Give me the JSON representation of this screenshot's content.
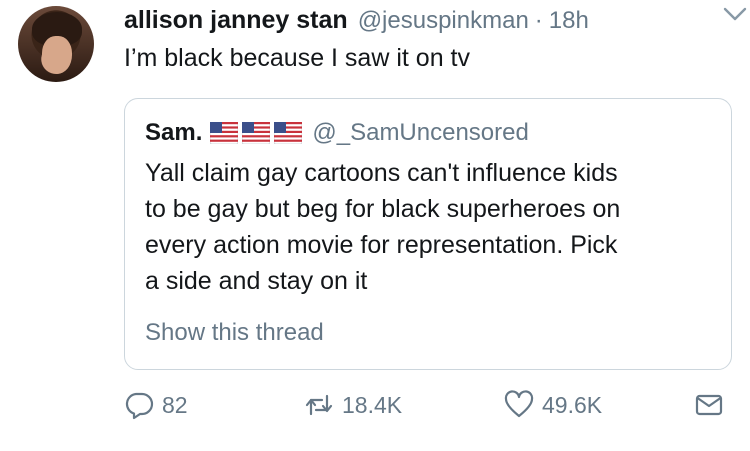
{
  "tweet": {
    "author_name": "allison janney stan",
    "author_handle": "@jesuspinkman",
    "separator": "·",
    "time": "18h",
    "text": "I’m black because I saw it on tv"
  },
  "quoted_tweet": {
    "author_name": "Sam.",
    "flag_icons": [
      "us-flag-icon",
      "us-flag-icon",
      "us-flag-icon"
    ],
    "author_handle": "@_SamUncensored",
    "lines": [
      "Yall claim gay cartoons can't influence kids",
      "to be gay but beg for black superheroes on",
      "every action movie for representation. Pick",
      "a side and stay on it"
    ],
    "show_thread": "Show this thread"
  },
  "actions": {
    "reply_count": "82",
    "retweet_count": "18.4K",
    "like_count": "49.6K"
  },
  "colors": {
    "text": "#14171a",
    "secondary": "#657786",
    "border": "#ccd6dd"
  }
}
